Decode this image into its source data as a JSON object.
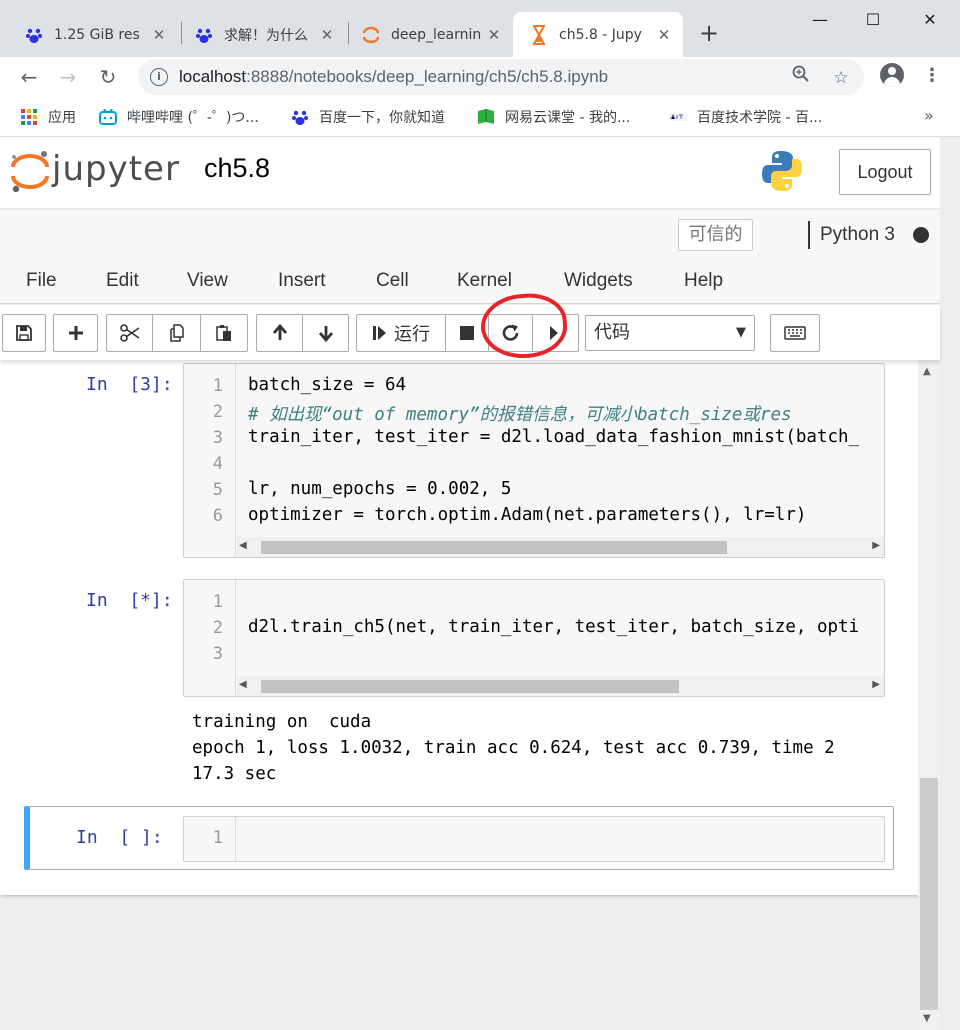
{
  "browser": {
    "tabs": [
      {
        "title": "1.25 GiB res",
        "active": false
      },
      {
        "title": "求解！为什么",
        "active": false
      },
      {
        "title": "deep_learnin",
        "active": false
      },
      {
        "title": "ch5.8 - Jupy",
        "active": true
      }
    ],
    "new_tab": "+",
    "window_controls": {
      "minimize": "—",
      "maximize": "☐",
      "close": "✕"
    },
    "url_host": "localhost",
    "url_rest": ":8888/notebooks/deep_learning/ch5/ch5.8.ipynb",
    "bookmarks": [
      {
        "label": "应用",
        "icon": "apps-grid-icon"
      },
      {
        "label": "哔哩哔哩 (゜-゜)つ...",
        "icon": "bilibili-icon"
      },
      {
        "label": "百度一下，你就知道",
        "icon": "baidu-paw-icon"
      },
      {
        "label": "网易云课堂 - 我的...",
        "icon": "netease-study-icon"
      },
      {
        "label": "百度技术学院 - 百...",
        "icon": "baidu-tech-icon"
      }
    ],
    "bookmarks_more": "»"
  },
  "jupyter": {
    "logo_text": "jupyter",
    "notebook_name": "ch5.8",
    "logout_label": "Logout",
    "trusted_label": "可信的",
    "kernel_name": "Python 3",
    "menu": [
      "File",
      "Edit",
      "View",
      "Insert",
      "Cell",
      "Kernel",
      "Widgets",
      "Help"
    ],
    "toolbar": {
      "run_label": "运行",
      "cell_type": "代码"
    },
    "colors": {
      "selected_cell_border": "#42a5f5",
      "prompt": "#303f9f",
      "annotation_red": "#e8232a"
    }
  },
  "cells": [
    {
      "prompt": "In  [3]:",
      "line_numbers": [
        "1",
        "2",
        "3",
        "4",
        "5",
        "6"
      ],
      "lines": [
        "batch_size = 64",
        "# 如出现“out of memory”的报错信息，可减小batch_size或res",
        "train_iter, test_iter = d2l.load_data_fashion_mnist(batch_",
        "",
        "lr, num_epochs = 0.002, 5",
        "optimizer = torch.optim.Adam(net.parameters(), lr=lr)"
      ]
    },
    {
      "prompt": "In  [*]:",
      "line_numbers": [
        "1",
        "2",
        "3"
      ],
      "lines": [
        "",
        "d2l.train_ch5(net, train_iter, test_iter, batch_size, opti",
        ""
      ],
      "output": [
        "training on  cuda",
        "epoch 1, loss 1.0032, train acc 0.624, test acc 0.739, time 2",
        "17.3 sec"
      ]
    },
    {
      "prompt": "In  [ ]:",
      "line_numbers": [
        "1"
      ],
      "lines": [
        ""
      ]
    }
  ]
}
